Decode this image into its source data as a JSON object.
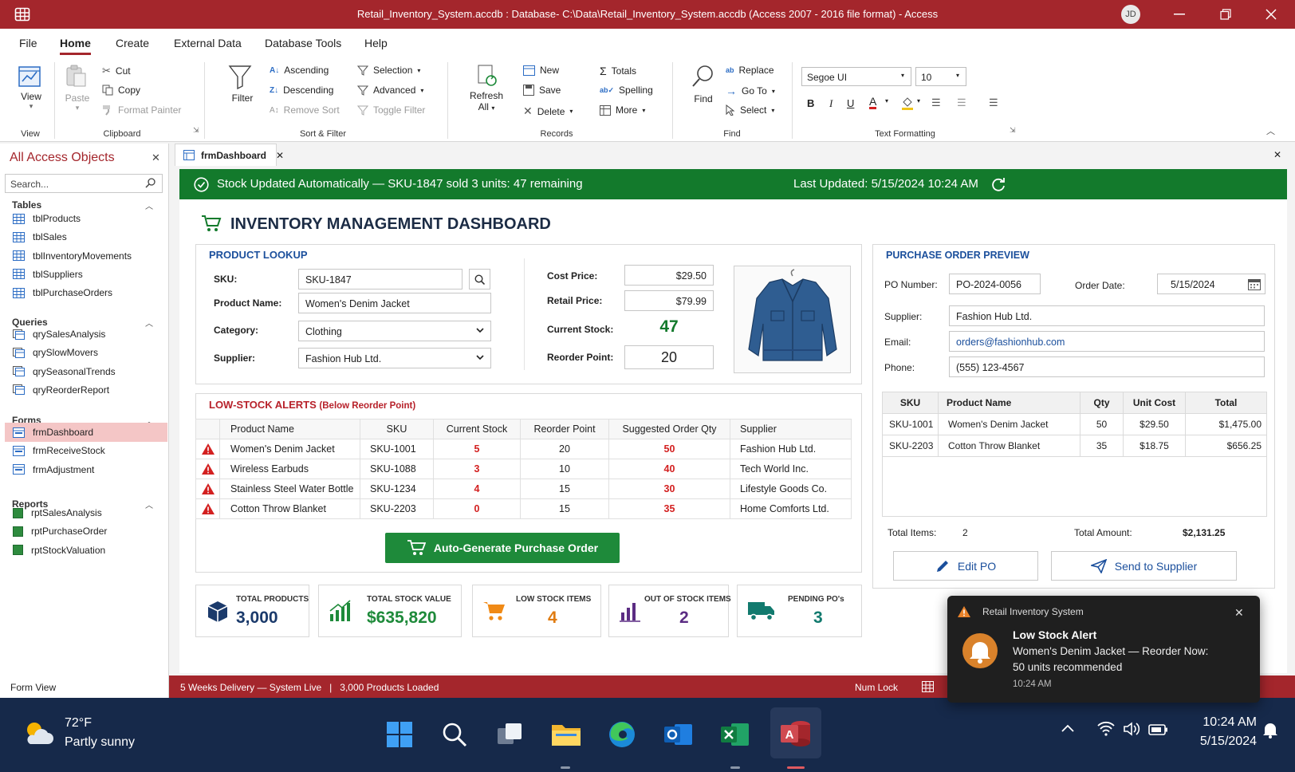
{
  "window": {
    "title": "Retail_Inventory_System.accdb : Database- C:\\Data\\Retail_Inventory_System.accdb (Access 2007 - 2016 file format)  -  Access",
    "user_initials": "JD"
  },
  "menu_tabs": [
    "File",
    "Home",
    "Create",
    "External Data",
    "Database Tools",
    "Help"
  ],
  "ribbon": {
    "view": {
      "label": "View",
      "group": "View"
    },
    "clipboard": {
      "paste": "Paste",
      "cut": "Cut",
      "copy": "Copy",
      "format_painter": "Format Painter",
      "group": "Clipboard"
    },
    "sort_filter": {
      "filter": "Filter",
      "ascending": "Ascending",
      "descending": "Descending",
      "remove_sort": "Remove Sort",
      "selection": "Selection",
      "advanced": "Advanced",
      "toggle_filter": "Toggle Filter",
      "group": "Sort & Filter"
    },
    "records": {
      "refresh_1": "Refresh",
      "refresh_2": "All",
      "new": "New",
      "save": "Save",
      "delete": "Delete",
      "totals": "Totals",
      "spelling": "Spelling",
      "more": "More",
      "group": "Records"
    },
    "find": {
      "find": "Find",
      "replace": "Replace",
      "goto": "Go To",
      "select": "Select",
      "group": "Find"
    },
    "text_formatting": {
      "font": "Segoe UI",
      "size": "10",
      "group": "Text Formatting"
    }
  },
  "nav": {
    "title": "All Access Objects",
    "search_placeholder": "Search...",
    "tables_label": "Tables",
    "tables": [
      "tblProducts",
      "tblSales",
      "tblInventoryMovements",
      "tblSuppliers",
      "tblPurchaseOrders"
    ],
    "queries_label": "Queries",
    "queries": [
      "qrySalesAnalysis",
      "qrySlowMovers",
      "qrySeasonalTrends",
      "qryReorderReport"
    ],
    "forms_label": "Forms",
    "forms": [
      "frmDashboard",
      "frmReceiveStock",
      "frmAdjustment"
    ],
    "reports_label": "Reports",
    "reports": [
      "rptSalesAnalysis",
      "rptPurchaseOrder",
      "rptStockValuation"
    ]
  },
  "doc_tab": "frmDashboard",
  "banner": {
    "message": "Stock Updated Automatically — SKU-1847 sold 3 units: 47 remaining",
    "last_updated": "Last Updated:  5/15/2024 10:24 AM"
  },
  "dashboard_title": "INVENTORY MANAGEMENT DASHBOARD",
  "lookup": {
    "title": "PRODUCT LOOKUP",
    "sku_label": "SKU:",
    "sku": "SKU-1847",
    "name_label": "Product Name:",
    "name": "Women's Denim Jacket",
    "category_label": "Category:",
    "category": "Clothing",
    "supplier_label": "Supplier:",
    "supplier": "Fashion Hub Ltd.",
    "cost_label": "Cost Price:",
    "cost": "$29.50",
    "retail_label": "Retail Price:",
    "retail": "$79.99",
    "stock_label": "Current Stock:",
    "stock": "47",
    "reorder_label": "Reorder Point:",
    "reorder": "20"
  },
  "alerts": {
    "title": "LOW-STOCK ALERTS",
    "subtitle": "(Below Reorder Point)",
    "columns": [
      "Product Name",
      "SKU",
      "Current Stock",
      "Reorder Point",
      "Suggested Order Qty",
      "Supplier"
    ],
    "rows": [
      {
        "name": "Women's Denim Jacket",
        "sku": "SKU-1001",
        "stock": "5",
        "reorder": "20",
        "suggested": "50",
        "supplier": "Fashion Hub Ltd."
      },
      {
        "name": "Wireless Earbuds",
        "sku": "SKU-1088",
        "stock": "3",
        "reorder": "10",
        "suggested": "40",
        "supplier": "Tech World Inc."
      },
      {
        "name": "Stainless Steel Water Bottle",
        "sku": "SKU-1234",
        "stock": "4",
        "reorder": "15",
        "suggested": "30",
        "supplier": "Lifestyle Goods Co."
      },
      {
        "name": "Cotton Throw Blanket",
        "sku": "SKU-2203",
        "stock": "0",
        "reorder": "15",
        "suggested": "35",
        "supplier": "Home Comforts Ltd."
      }
    ],
    "button": "Auto-Generate Purchase Order"
  },
  "kpis": [
    {
      "label": "TOTAL PRODUCTS",
      "value": "3,000",
      "icon": "cube-icon",
      "color": "#1b3a6b"
    },
    {
      "label": "TOTAL STOCK VALUE",
      "value": "$635,820",
      "icon": "bar-growth-icon",
      "color": "#1e8a3a"
    },
    {
      "label": "LOW STOCK ITEMS",
      "value": "4",
      "icon": "shopping-cart-icon",
      "color": "#e07b10"
    },
    {
      "label": "OUT OF STOCK ITEMS",
      "value": "2",
      "icon": "bar-chart-icon",
      "color": "#5b2c83"
    },
    {
      "label": "PENDING PO's",
      "value": "3",
      "icon": "truck-icon",
      "color": "#127a6e"
    }
  ],
  "po": {
    "title": "PURCHASE ORDER PREVIEW",
    "number_label": "PO Number:",
    "number": "PO-2024-0056",
    "date_label": "Order Date:",
    "date": "5/15/2024",
    "supplier_label": "Supplier:",
    "supplier": "Fashion Hub Ltd.",
    "email_label": "Email:",
    "email": "orders@fashionhub.com",
    "phone_label": "Phone:",
    "phone": "(555) 123-4567",
    "columns": [
      "SKU",
      "Product Name",
      "Qty",
      "Unit Cost",
      "Total"
    ],
    "rows": [
      {
        "sku": "SKU-1001",
        "name": "Women's Denim Jacket",
        "qty": "50",
        "unit": "$29.50",
        "total": "$1,475.00"
      },
      {
        "sku": "SKU-2203",
        "name": "Cotton Throw Blanket",
        "qty": "35",
        "unit": "$18.75",
        "total": "$656.25"
      }
    ],
    "total_items_label": "Total Items:",
    "total_items": "2",
    "total_amount_label": "Total Amount:",
    "total_amount": "$2,131.25",
    "edit_button": "Edit PO",
    "send_button": "Send to Supplier"
  },
  "status": {
    "left": "Form View",
    "message": "5 Weeks Delivery — System Live",
    "products_loaded": "3,000 Products Loaded",
    "numlock": "Num Lock"
  },
  "toast": {
    "app": "Retail Inventory System",
    "title": "Low Stock Alert",
    "line1": "Women's Denim Jacket — Reorder Now:",
    "line2": "50 units recommended",
    "time": "10:24 AM"
  },
  "taskbar": {
    "temp": "72°F",
    "weather": "Partly sunny",
    "time": "10:24 AM",
    "date": "5/15/2024"
  },
  "colors": {
    "accent": "#a4262c",
    "banner": "#137a2c",
    "alert_red": "#d32020",
    "heading_blue": "#1b4f9c"
  }
}
